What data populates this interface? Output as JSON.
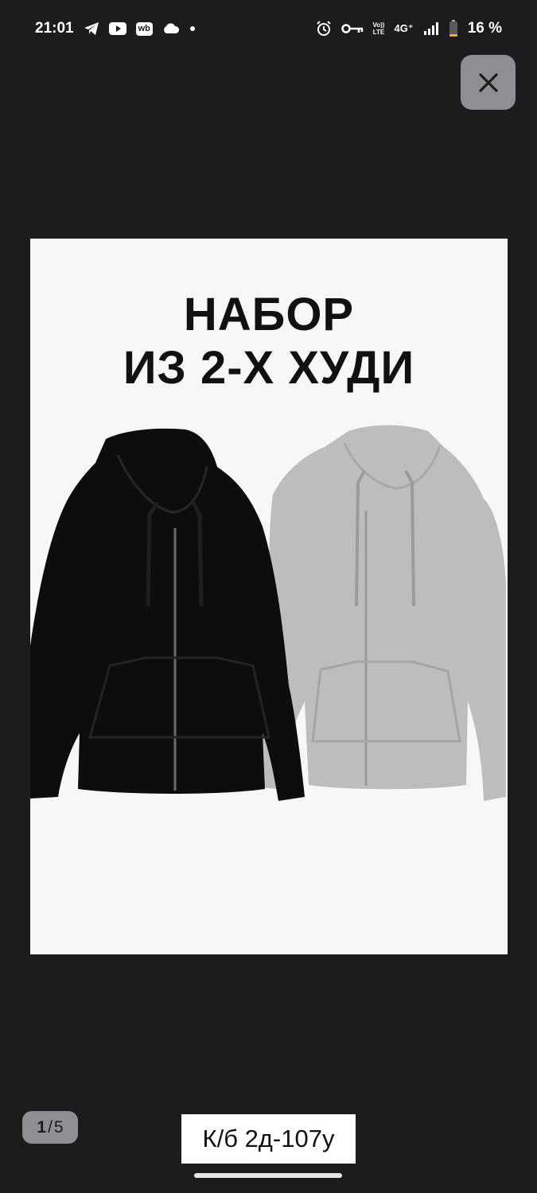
{
  "status_bar": {
    "time": "21:01",
    "left_icons": [
      "telegram-icon",
      "youtube-icon",
      "wb-app-icon",
      "cloud-icon",
      "dot-icon"
    ],
    "wb_label": "wb",
    "right_icons": [
      "alarm-icon",
      "vpn-key-icon",
      "volte-icon",
      "network-4g-icon",
      "signal-icon",
      "battery-icon"
    ],
    "network": "4G⁺",
    "volte_top": "Vo))",
    "volte_bottom": "LTE",
    "battery": "16 %",
    "battery_level": 0.16
  },
  "viewer": {
    "close_icon": "close-icon",
    "image": {
      "title_line1": "НАБОР",
      "title_line2": "ИЗ 2-Х ХУДИ"
    },
    "page_current": "1",
    "page_separator": "/",
    "page_total": "5",
    "sku": "К/б 2д-107у"
  },
  "colors": {
    "background": "#1c1c1e",
    "button": "#8e8e93",
    "image_background": "#f7f7f7",
    "hoodie_black": "#0d0d0d",
    "hoodie_gray": "#bdbdbd"
  }
}
